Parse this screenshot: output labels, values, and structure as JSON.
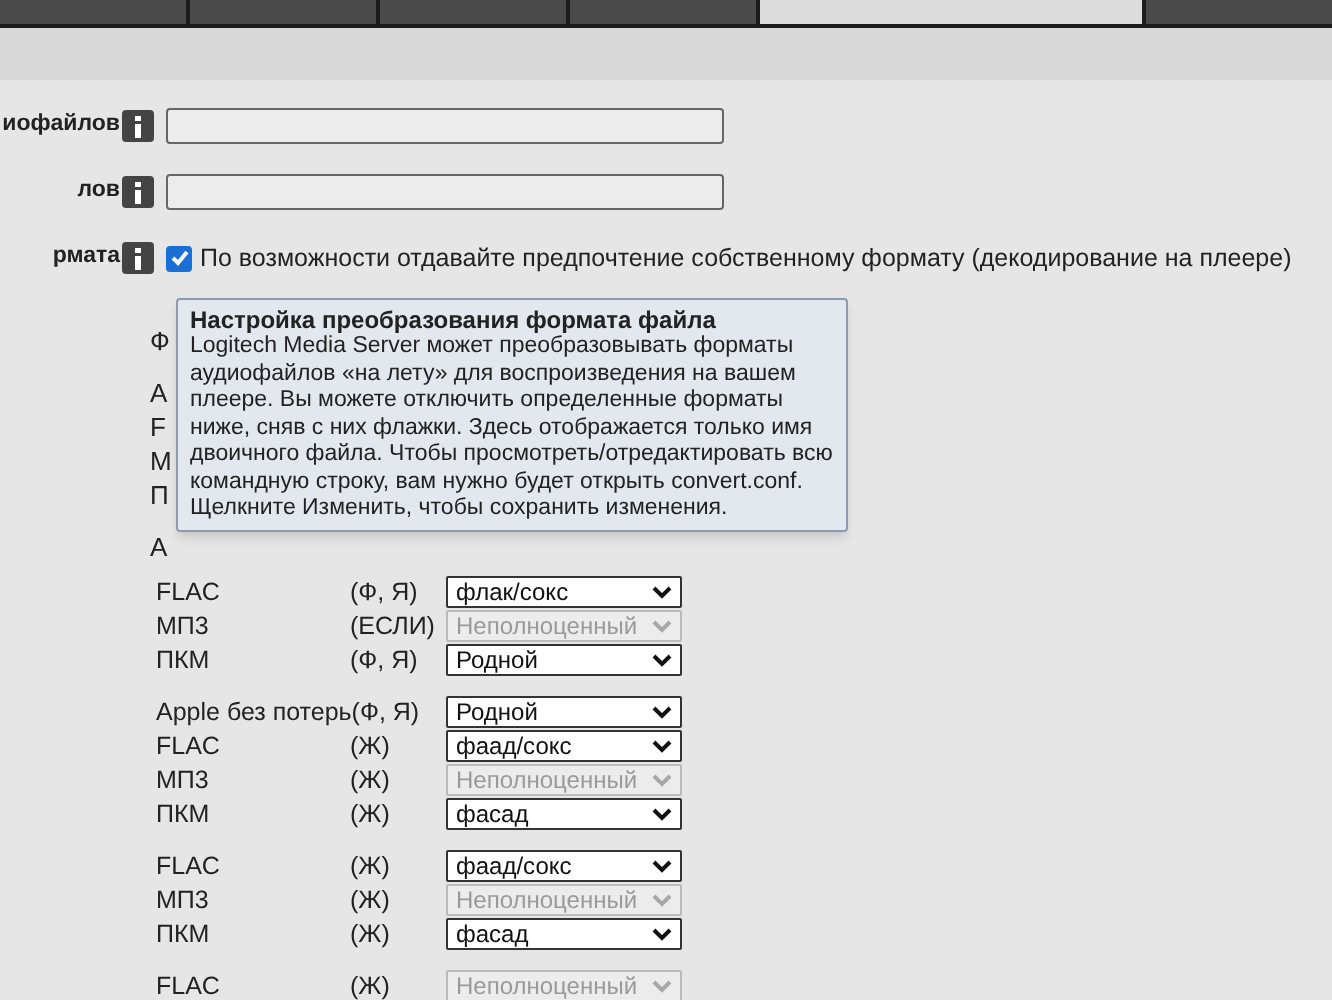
{
  "tabs": [
    {
      "selected": false
    },
    {
      "selected": false
    },
    {
      "selected": false
    },
    {
      "selected": false
    },
    {
      "selected": true
    },
    {
      "selected": false
    }
  ],
  "fields": [
    {
      "label": "иофайлов",
      "kind": "text"
    },
    {
      "label": "лов",
      "kind": "text"
    },
    {
      "label": "рмата",
      "kind": "checkbox",
      "checked": true,
      "text": "По возможности отдавайте предпочтение собственному формату (декодирование на плеере)"
    }
  ],
  "covered_labels": [
    "Ф",
    "А",
    "F",
    "М",
    "П",
    "А"
  ],
  "tooltip": {
    "title": "Настройка преобразования формата файла",
    "body": "Logitech Media Server может преобразовывать форматы аудиофайлов «на лету» для воспроизведения на вашем плеере. Вы можете отключить определенные форматы ниже, сняв с них флажки. Здесь отображается только имя двоичного файла. Чтобы просмотреть/отредактировать всю командную строку, вам нужно будет открыть convert.conf. Щелкните Изменить, чтобы сохранить изменения."
  },
  "groups": [
    {
      "rows": [
        {
          "name": "FLAC",
          "codes": "(Ф, Я)",
          "value": "флак/сокс",
          "disabled": false
        },
        {
          "name": "МП3",
          "codes": "(ЕСЛИ)",
          "value": "Неполноценный",
          "disabled": true
        },
        {
          "name": "ПКМ",
          "codes": "(Ф, Я)",
          "value": "Родной",
          "disabled": false
        }
      ]
    },
    {
      "rows": [
        {
          "name": "Apple без потерь(Ф, Я)",
          "value": "Родной",
          "disabled": false
        },
        {
          "name": "FLAC",
          "codes": "(Ж)",
          "value": "фаад/сокс",
          "disabled": false
        },
        {
          "name": "МП3",
          "codes": "(Ж)",
          "value": "Неполноценный",
          "disabled": true
        },
        {
          "name": "ПКМ",
          "codes": "(Ж)",
          "value": "фасад",
          "disabled": false
        }
      ]
    },
    {
      "rows": [
        {
          "name": "FLAC",
          "codes": "(Ж)",
          "value": "фаад/сокс",
          "disabled": false
        },
        {
          "name": "МП3",
          "codes": "(Ж)",
          "value": "Неполноценный",
          "disabled": true
        },
        {
          "name": "ПКМ",
          "codes": "(Ж)",
          "value": "фасад",
          "disabled": false
        }
      ]
    },
    {
      "rows": [
        {
          "name": "FLAC",
          "codes": "(Ж)",
          "value": "Неполноценный",
          "disabled": true
        }
      ]
    }
  ]
}
